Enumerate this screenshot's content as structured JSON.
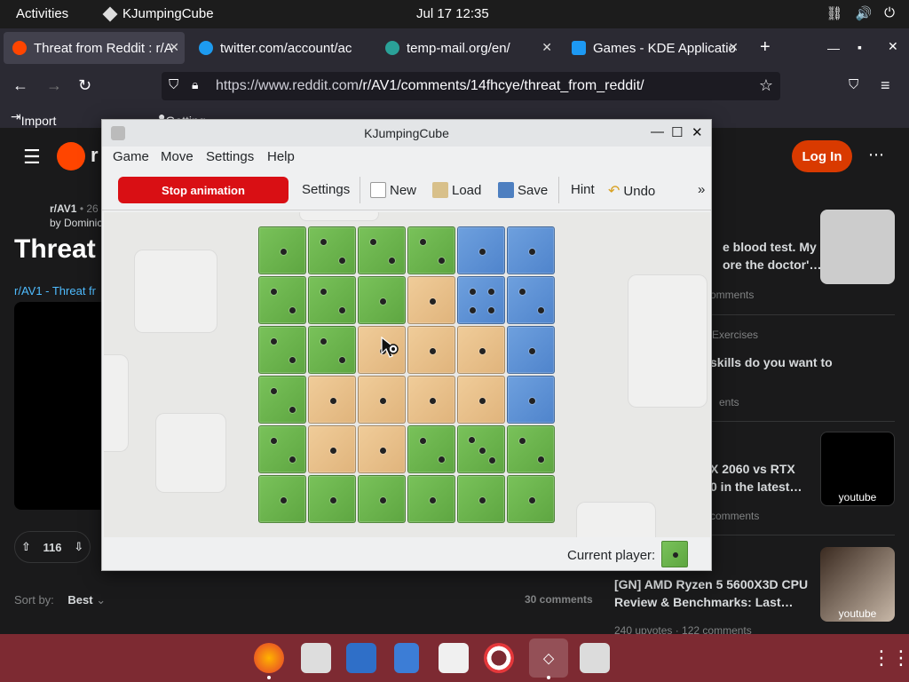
{
  "topbar": {
    "activities": "Activities",
    "app_name": "KJumpingCube",
    "clock": "Jul 17  12:35",
    "tray_icons": [
      "network-icon",
      "volume-icon",
      "power-icon"
    ]
  },
  "browser": {
    "tabs": [
      {
        "label": "Threat from Reddit : r/A",
        "icon": "reddit-icon",
        "color": "#ff4500"
      },
      {
        "label": "twitter.com/account/ac",
        "icon": "twitter-icon",
        "color": "#1d9bf0"
      },
      {
        "label": "temp-mail.org/en/",
        "icon": "tempmail-icon",
        "color": "#2aa198"
      },
      {
        "label": "Games - KDE Applicatio",
        "icon": "kde-icon",
        "color": "#1d99f3"
      }
    ],
    "new_tab": "+",
    "url_prefix": "https://www.reddit.com",
    "url_path": "/r/AV1/comments/14fhcye/threat_from_reddit/",
    "bookmarks": [
      "Import bookmarks",
      "Getting Started"
    ]
  },
  "reddit": {
    "logo_text": "r",
    "login": "Log In",
    "subreddit": "r/AV1",
    "subreddit_meta": "• 26",
    "author": "by Dominic",
    "title": "Threat",
    "link_text": "r/AV1 - Threat fr",
    "votes": "116",
    "sort_label": "Sort by:",
    "sort_value": "Best",
    "comments_count": "30 comments",
    "sidebar": [
      {
        "title": "e blood test. My",
        "title2": "ore the doctor'…",
        "meta": "omments"
      },
      {
        "category": "Exercises",
        "title": "skills do you want to",
        "meta": "ents"
      },
      {
        "title": "X 2060 vs RTX",
        "title2": "0 in the latest…",
        "meta": "comments",
        "thumb_caption": "youtube"
      },
      {
        "title": "[GN] AMD Ryzen 5 5600X3D CPU",
        "title2": "Review & Benchmarks: Last…",
        "meta": "240 upvotes · 122 comments",
        "thumb_caption": "youtube"
      }
    ]
  },
  "kjc": {
    "title": "KJumpingCube",
    "menu": [
      "Game",
      "Move",
      "Settings",
      "Help"
    ],
    "toolbar": {
      "stop": "Stop animation",
      "settings": "Settings",
      "new": "New",
      "load": "Load",
      "save": "Save",
      "hint": "Hint",
      "undo": "Undo",
      "more": "»"
    },
    "board": [
      [
        [
          "green",
          1
        ],
        [
          "green",
          2
        ],
        [
          "green",
          2
        ],
        [
          "green",
          2
        ],
        [
          "blue",
          1
        ],
        [
          "blue",
          1
        ]
      ],
      [
        [
          "green",
          2
        ],
        [
          "green",
          2
        ],
        [
          "green",
          1
        ],
        [
          "orange",
          1
        ],
        [
          "blue",
          4
        ],
        [
          "blue",
          2
        ]
      ],
      [
        [
          "green",
          2
        ],
        [
          "green",
          2
        ],
        [
          "orange",
          1
        ],
        [
          "orange",
          1
        ],
        [
          "orange",
          1
        ],
        [
          "blue",
          1
        ]
      ],
      [
        [
          "green",
          2
        ],
        [
          "orange",
          1
        ],
        [
          "orange",
          1
        ],
        [
          "orange",
          1
        ],
        [
          "orange",
          1
        ],
        [
          "blue",
          1
        ]
      ],
      [
        [
          "green",
          2
        ],
        [
          "orange",
          1
        ],
        [
          "orange",
          1
        ],
        [
          "green",
          2
        ],
        [
          "green",
          3
        ],
        [
          "green",
          2
        ]
      ],
      [
        [
          "green",
          1
        ],
        [
          "green",
          1
        ],
        [
          "green",
          1
        ],
        [
          "green",
          1
        ],
        [
          "green",
          1
        ],
        [
          "green",
          1
        ]
      ]
    ],
    "current_player_label": "Current player:",
    "current_player_color": "green"
  },
  "dock": {
    "apps": [
      "firefox-icon",
      "software-updater-icon",
      "text-editor-icon",
      "document-viewer-icon",
      "software-store-icon",
      "help-icon",
      "kjumpingcube-icon",
      "trash-icon"
    ]
  },
  "colors": {
    "cube_green": "#6cb34d",
    "cube_orange": "#e8c08a",
    "cube_blue": "#5f92d6",
    "stop_button": "#d90f14",
    "reddit_login": "#d93a00",
    "dock_bg": "#7d2a32"
  }
}
